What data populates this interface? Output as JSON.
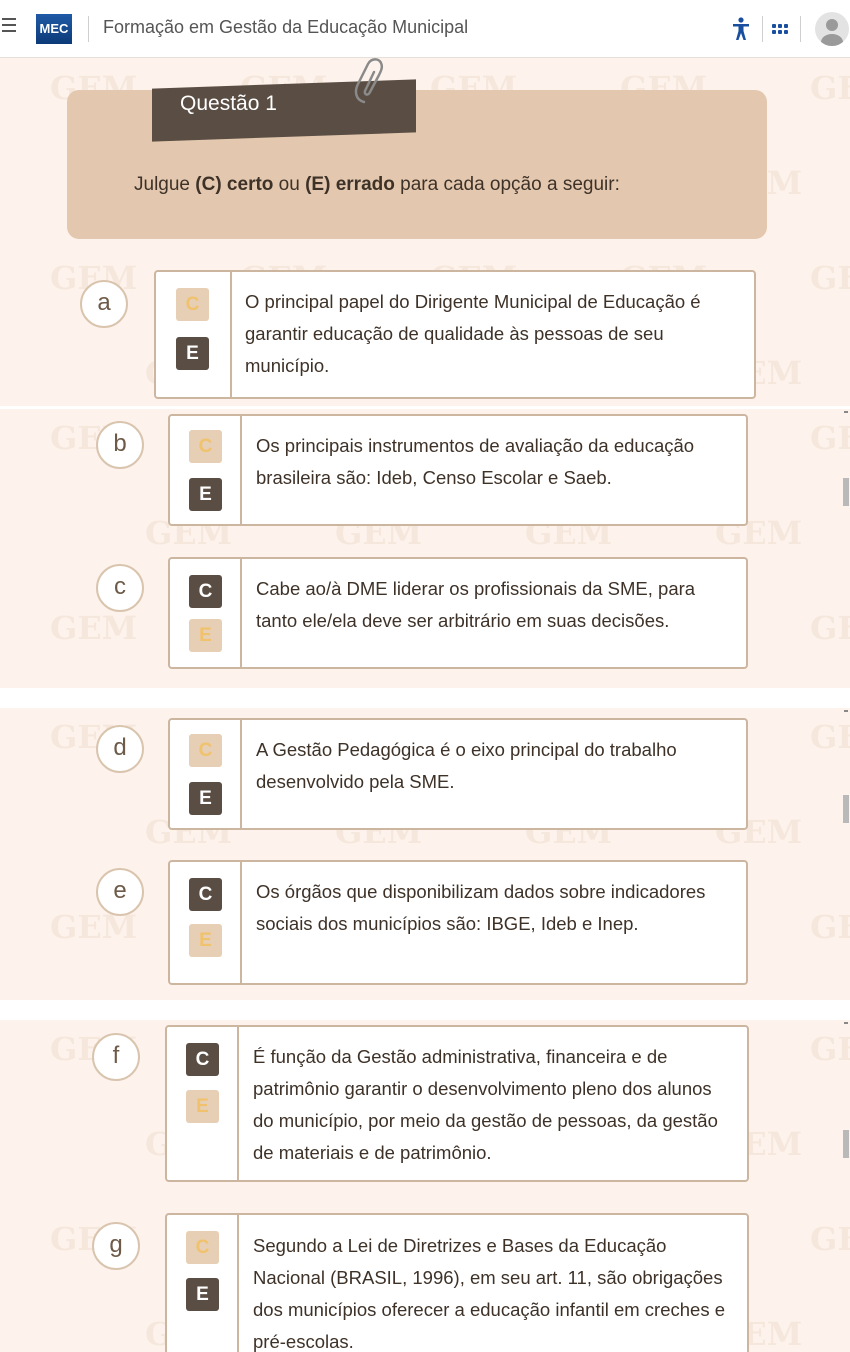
{
  "header": {
    "logo_text": "MEC",
    "title": "Formação em Gestão da Educação Municipal",
    "accent_color": "#1a4fa0"
  },
  "question": {
    "tag": "Questão 1",
    "instruction_prefix": "Julgue ",
    "certo_marker": "(C) certo",
    "middle": " ou ",
    "errado_marker": "(E) errado",
    "instruction_suffix": " para cada opção a seguir:"
  },
  "watermark_text": "GEM",
  "option_labels": {
    "c": "C",
    "e": "E"
  },
  "items": [
    {
      "letter": "a",
      "selected": "E",
      "text": "O principal papel do Dirigente Municipal de Educação é garantir educação de qualidade às pessoas de seu município."
    },
    {
      "letter": "b",
      "selected": "E",
      "text": "Os principais instrumentos de avaliação da educação brasileira são: Ideb, Censo Escolar e Saeb."
    },
    {
      "letter": "c",
      "selected": "C",
      "text": "Cabe ao/à DME liderar os profissionais da SME, para tanto ele/ela deve ser arbitrário em suas decisões."
    },
    {
      "letter": "d",
      "selected": "E",
      "text": "A Gestão Pedagógica é o eixo principal do trabalho desenvolvido pela SME."
    },
    {
      "letter": "e",
      "selected": "C",
      "text": "Os órgãos que disponibilizam dados sobre indicadores sociais dos municípios são: IBGE, Ideb e Inep."
    },
    {
      "letter": "f",
      "selected": "C",
      "text": "É função da Gestão administrativa, financeira e de patrimônio garantir o desenvolvimento pleno dos alunos do município, por meio da gestão de pessoas, da gestão de materiais e de patrimônio."
    },
    {
      "letter": "g",
      "selected": "E",
      "text": "Segundo a Lei de Diretrizes e Bases da Educação Nacional (BRASIL, 1996), em seu art. 11, são obrigações dos municípios oferecer a educação infantil em creches e pré-escolas."
    }
  ]
}
